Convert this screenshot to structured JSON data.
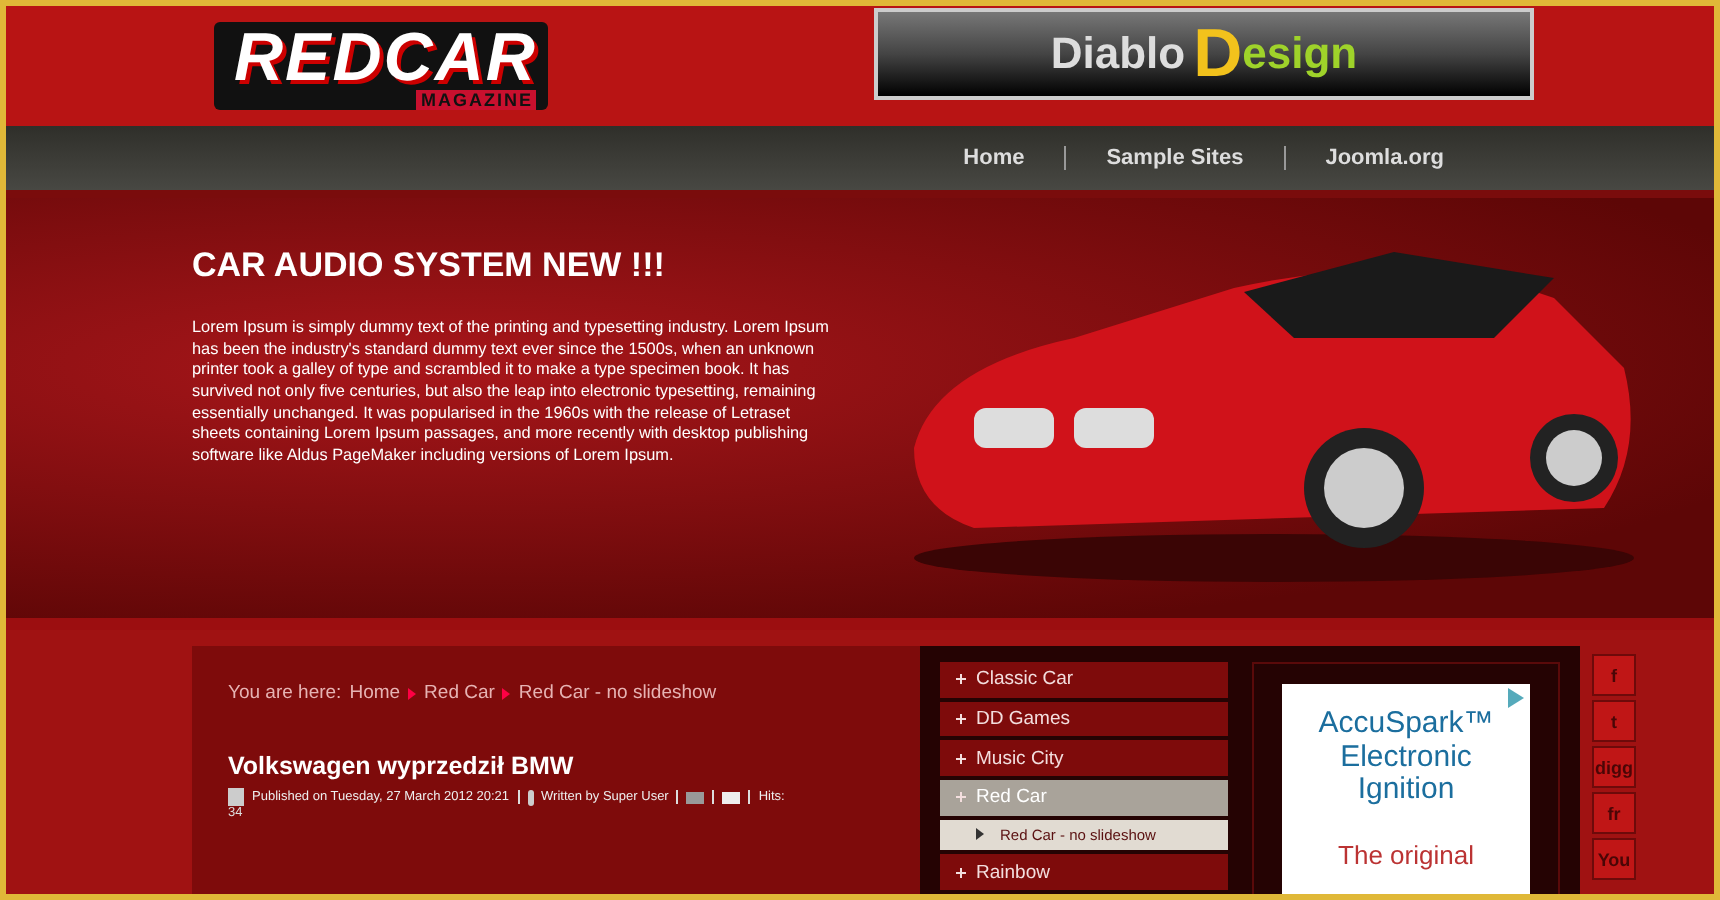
{
  "logo": {
    "title": "REDCAR",
    "subtitle": "MAGAZINE"
  },
  "banner": {
    "words": [
      "Diablo",
      "D",
      "esign"
    ]
  },
  "nav": [
    {
      "label": "Home",
      "selected": false
    },
    {
      "label": "Sample Sites",
      "selected": false
    },
    {
      "label": "Joomla.org",
      "selected": false
    }
  ],
  "hero": {
    "title": "CAR AUDIO SYSTEM NEW !!!",
    "text": "Lorem Ipsum is simply dummy text of the printing and typesetting industry. Lorem Ipsum has been the industry's standard dummy text ever since the 1500s, when an unknown printer took a galley of type and scrambled it to make a type specimen book. It has survived not only five centuries, but also the leap into electronic typesetting, remaining essentially unchanged. It was popularised in the 1960s with the release of Letraset sheets containing Lorem Ipsum passages, and more recently with desktop publishing software like Aldus PageMaker including versions of Lorem Ipsum."
  },
  "breadcrumb": {
    "prefix": "You are here:",
    "items": [
      "Home",
      "Red Car",
      "Red Car - no slideshow"
    ]
  },
  "article": {
    "title": "Volkswagen wyprzedził BMW",
    "published": "Published on Tuesday, 27 March 2012 20:21",
    "author": "Written by Super User",
    "hits": "Hits:",
    "hits_count": "34"
  },
  "menu": [
    {
      "label": "Classic Car",
      "selected": false
    },
    {
      "label": "DD Games",
      "selected": false
    },
    {
      "label": "Music City",
      "selected": false
    },
    {
      "label": "Red Car",
      "selected": true,
      "children": [
        {
          "label": "Red Car - no slideshow"
        }
      ]
    },
    {
      "label": "Rainbow",
      "selected": false
    }
  ],
  "ad": {
    "title": "AccuSpark™ Electronic Ignition",
    "subtitle": "The original"
  },
  "social": [
    "f",
    "t",
    "digg",
    "fr",
    "You"
  ]
}
